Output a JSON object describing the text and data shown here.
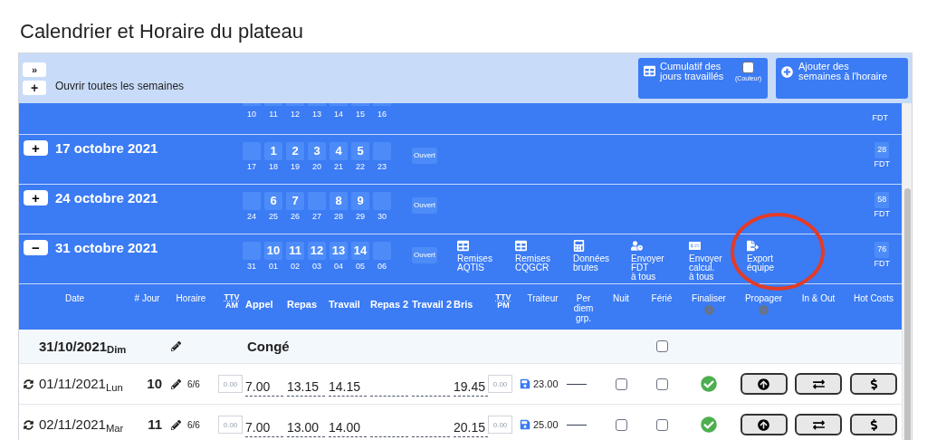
{
  "page_title": "Calendrier et Horaire du plateau",
  "toolbar": {
    "collapse_button": "»",
    "open_all_button": "+",
    "open_all_label": "Ouvrir toutes les semaines",
    "cumulative_button": "Cumulatif des jours travaillés",
    "color_toggle": {
      "label": "(Couleur)",
      "checked": false
    },
    "add_weeks_button": "Ajouter des semaines à l'horaire"
  },
  "weeks": [
    {
      "days": [
        {
          "date": "10"
        },
        {
          "date": "11"
        },
        {
          "date": "12"
        },
        {
          "date": "13"
        },
        {
          "date": "14"
        },
        {
          "date": "15"
        },
        {
          "date": "16"
        }
      ],
      "fdt_label": "FDT"
    },
    {
      "toggle": "+",
      "title": "17 octobre 2021",
      "days": [
        {
          "date": "17"
        },
        {
          "number": "1",
          "date": "18"
        },
        {
          "number": "2",
          "date": "19"
        },
        {
          "number": "3",
          "date": "20"
        },
        {
          "number": "4",
          "date": "21"
        },
        {
          "number": "5",
          "date": "22"
        },
        {
          "date": "23"
        }
      ],
      "status": "Ouvert",
      "fdt_count": "28",
      "fdt_label": "FDT"
    },
    {
      "toggle": "+",
      "title": "24 octobre 2021",
      "days": [
        {
          "date": "24"
        },
        {
          "number": "6",
          "date": "25"
        },
        {
          "number": "7",
          "date": "26"
        },
        {
          "date": "27"
        },
        {
          "number": "8",
          "date": "28"
        },
        {
          "number": "9",
          "date": "29"
        },
        {
          "date": "30"
        }
      ],
      "status": "Ouvert",
      "fdt_count": "58",
      "fdt_label": "FDT"
    },
    {
      "toggle": "−",
      "title": "31 octobre 2021",
      "days": [
        {
          "date": "31"
        },
        {
          "number": "10",
          "date": "01"
        },
        {
          "number": "11",
          "date": "02"
        },
        {
          "number": "12",
          "date": "03"
        },
        {
          "number": "13",
          "date": "04"
        },
        {
          "number": "14",
          "date": "05"
        },
        {
          "date": "06"
        }
      ],
      "status": "Ouvert",
      "actions": [
        "Remises\nAQTIS",
        "Remises\nCQGCR",
        "Données\nbrutes",
        "Envoyer\nFDT\nà tous",
        "Envoyer\ncalcul.\nà tous",
        "Export\néquipe"
      ],
      "fdt_count": "76",
      "fdt_label": "FDT"
    }
  ],
  "table": {
    "columns": [
      {
        "label": "Date"
      },
      {
        "label": "# Jour"
      },
      {
        "label": "Horaire"
      },
      {
        "kind": "abbr",
        "label": "TTV",
        "sub": "AM"
      },
      {
        "kind": "time",
        "label": "Appel"
      },
      {
        "kind": "time",
        "label": "Repas"
      },
      {
        "kind": "time",
        "label": "Travail"
      },
      {
        "kind": "time",
        "label": "Repas 2"
      },
      {
        "kind": "time",
        "label": "Travail 2"
      },
      {
        "kind": "time",
        "label": "Bris"
      },
      {
        "kind": "abbr",
        "label": "TTV",
        "sub": "PM"
      },
      {
        "label": "Traiteur"
      },
      {
        "label": "Per diem grp."
      },
      {
        "label": "Nuit"
      },
      {
        "label": "Férié"
      },
      {
        "label": "Finaliser",
        "info": true
      },
      {
        "label": "Propager",
        "info": true
      },
      {
        "label": "In & Out"
      },
      {
        "label": "Hot Costs"
      }
    ],
    "rows": [
      {
        "kind": "leave",
        "date": "31/10/2021$_{Dim}$",
        "label": "Congé",
        "ferie": false
      },
      {
        "kind": "work",
        "date": "01/11/2021$_{Lun}$",
        "jour": "10",
        "horaire": "6/6",
        "ttv_am": {
          "placeholder": "0.00"
        },
        "times": {
          "appel": "7.00",
          "repas": "13.15",
          "travail": "14.15",
          "bris": "19.45"
        },
        "ttv_pm": {
          "placeholder": "0.00"
        },
        "traiteur": "23.00",
        "nuit": false,
        "ferie": false,
        "finalised": true
      },
      {
        "kind": "work",
        "date": "02/11/2021$_{Mar}$",
        "jour": "11",
        "horaire": "6/6",
        "ttv_am": {
          "placeholder": "0.00"
        },
        "times": {
          "appel": "7.00",
          "repas": "13.00",
          "travail": "14.00",
          "bris": "20.15"
        },
        "ttv_pm": {
          "placeholder": "0.00"
        },
        "traiteur": "25.00",
        "nuit": false,
        "ferie": false,
        "finalised": true
      }
    ]
  }
}
